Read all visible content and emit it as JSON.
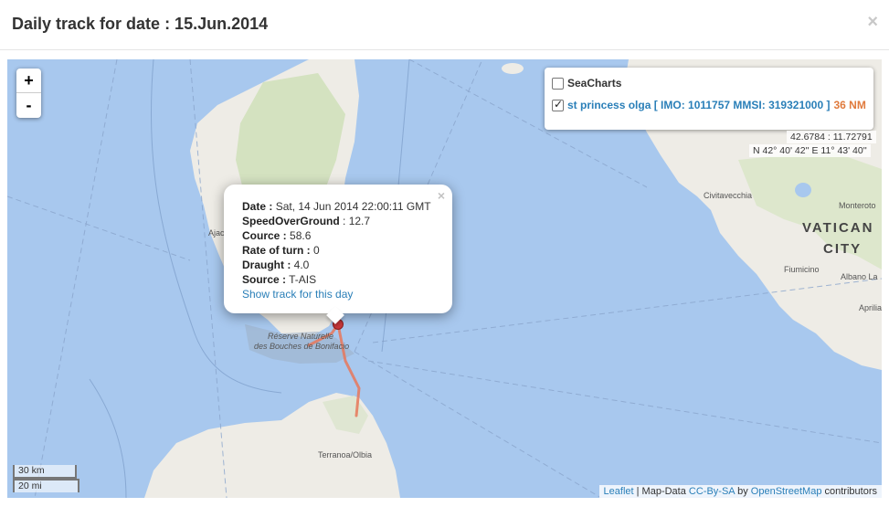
{
  "header": {
    "title": "Daily track for date : 15.Jun.2014",
    "close": "×"
  },
  "map": {
    "zoom_in": "+",
    "zoom_out": "-",
    "layers": {
      "seacharts": "SeaCharts",
      "vessel": "st princess olga [ IMO: 1011757 MMSI: 319321000 ]",
      "distance": "36 NM"
    },
    "coord_decimal": "42.6784 : 11.72791",
    "coord_dms": "N 42° 40' 42'' E 11° 43' 40''",
    "popup": {
      "close": "×",
      "date_label": "Date :",
      "date_value": "Sat, 14 Jun 2014 22:00:11 GMT",
      "sog_label": "SpeedOverGround",
      "sog_value": ": 12.7",
      "course_label": "Cource :",
      "course_value": "58.6",
      "rot_label": "Rate of turn :",
      "rot_value": "0",
      "draught_label": "Draught :",
      "draught_value": "4.0",
      "source_label": "Source :",
      "source_value": "T-AIS",
      "link": "Show track for this day"
    },
    "scale": {
      "km": "30 km",
      "mi": "20 mi"
    },
    "attribution": {
      "leaflet": "Leaflet",
      "sep": "| Map-Data",
      "license": "CC-By-SA",
      "by": "by",
      "osm": "OpenStreetMap",
      "contributors": "contributors"
    },
    "places": {
      "civitavecchia": "Civitavecchia",
      "monterotondo": "Monteroto",
      "vatican": "VATICAN",
      "city": "CITY",
      "fiumicino": "Fiumicino",
      "albano": "Albano La",
      "aprilia": "Aprilia",
      "ajaccio": "Ajac",
      "reserve1": "Réserve Naturelle",
      "reserve2": "des Bouches de Bonifacio",
      "olbia": "Terranoa/Olbia"
    }
  }
}
